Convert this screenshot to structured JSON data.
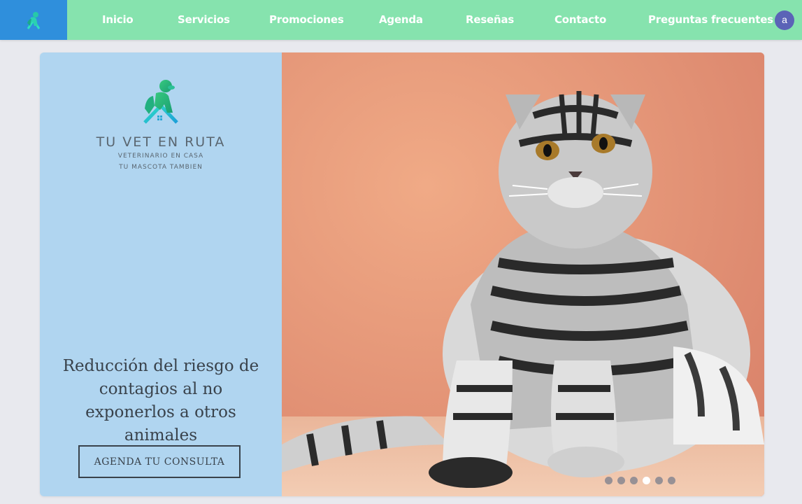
{
  "nav": {
    "items": [
      {
        "label": "Inicio"
      },
      {
        "label": "Servicios"
      },
      {
        "label": "Promociones"
      },
      {
        "label": "Agenda"
      },
      {
        "label": "Reseñas"
      },
      {
        "label": "Contacto"
      },
      {
        "label": "Preguntas frecuentes"
      }
    ],
    "avatar_initial": "a"
  },
  "brand": {
    "name": "TU VET EN RUTA",
    "tagline_1": "VETERINARIO EN CASA",
    "tagline_2": "TU MASCOTA TAMBIEN"
  },
  "hero": {
    "headline": "Reducción del riesgo de contagios al no exponerlos a otros animales",
    "cta_label": "AGENDA TU CONSULTA",
    "slide_count": 6,
    "active_slide": 4
  },
  "colors": {
    "topbar": "#86e3ae",
    "logo_box": "#2f8fdc",
    "left_panel": "#b0d5f0",
    "text_dark": "#39424b",
    "avatar": "#5b63b7"
  }
}
